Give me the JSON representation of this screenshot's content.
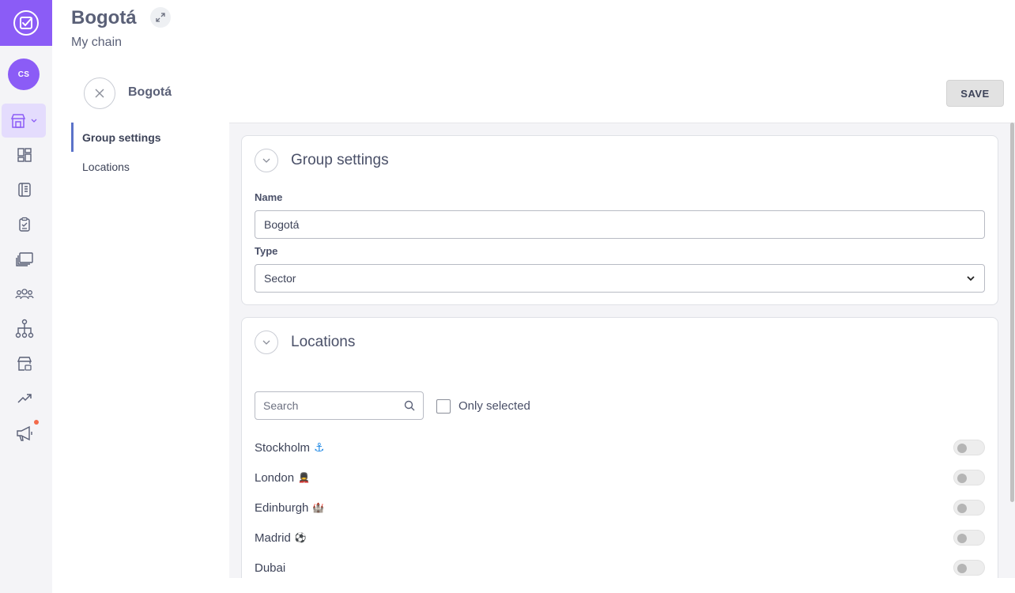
{
  "app": {
    "avatar_initials": "CS",
    "accent_color": "#8b5cf6"
  },
  "header": {
    "title": "Bogotá",
    "subtitle": "My chain"
  },
  "group_bar": {
    "name": "Bogotá",
    "save_label": "SAVE"
  },
  "subnav": {
    "items": [
      {
        "label": "Group settings",
        "active": true
      },
      {
        "label": "Locations",
        "active": false
      }
    ]
  },
  "group_settings": {
    "title": "Group settings",
    "name_label": "Name",
    "name_value": "Bogotá",
    "type_label": "Type",
    "type_value": "Sector"
  },
  "locations": {
    "title": "Locations",
    "search_placeholder": "Search",
    "only_selected_label": "Only selected",
    "items": [
      {
        "name": "Stockholm",
        "emoji": "⚓",
        "enabled": false
      },
      {
        "name": "London",
        "emoji": "💂",
        "enabled": false
      },
      {
        "name": "Edinburgh",
        "emoji": "🏰",
        "enabled": false
      },
      {
        "name": "Madrid",
        "emoji": "⚽",
        "enabled": false
      },
      {
        "name": "Dubai",
        "emoji": "",
        "enabled": false
      }
    ]
  },
  "icons": [
    "checklist-logo-icon",
    "store-icon",
    "dashboard-icon",
    "notebook-icon",
    "clipboard-icon",
    "gallery-icon",
    "team-icon",
    "hierarchy-icon",
    "shop-settings-icon",
    "trend-icon",
    "megaphone-icon"
  ]
}
